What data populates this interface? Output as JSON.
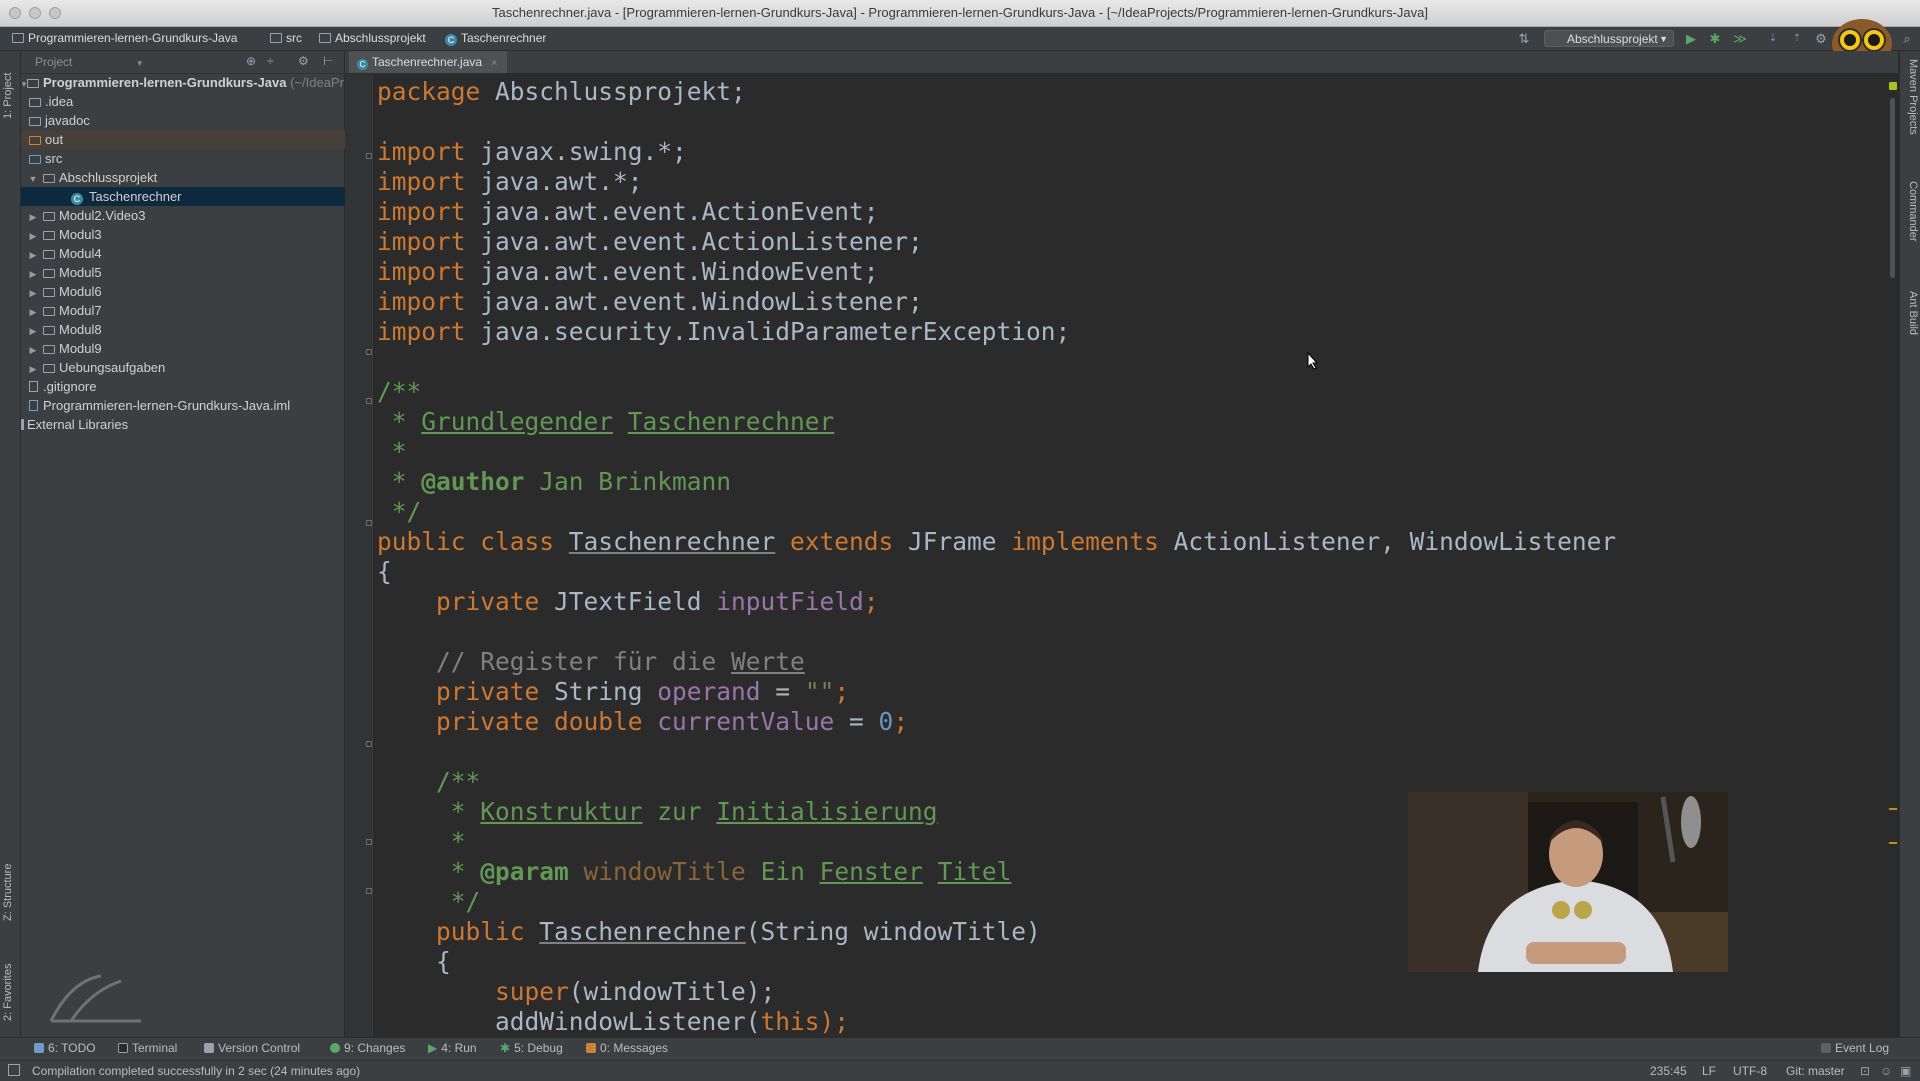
{
  "window": {
    "title": "Taschenrechner.java - [Programmieren-lernen-Grundkurs-Java] - Programmieren-lernen-Grundkurs-Java - [~/IdeaProjects/Programmieren-lernen-Grundkurs-Java]"
  },
  "breadcrumb": [
    "Programmieren-lernen-Grundkurs-Java",
    "src",
    "Abschlussprojekt",
    "Taschenrechner"
  ],
  "toolbar": {
    "run_config": "Abschlussprojekt"
  },
  "left_stripe": {
    "project_tab": "1: Project",
    "structure_tab": "Z: Structure",
    "favorites_tab": "2: Favorites"
  },
  "right_stripe": {
    "maven_tab": "Maven Projects",
    "commander_tab": "Commander",
    "ant_tab": "Ant Build"
  },
  "project": {
    "view_label": "Project",
    "root": {
      "name": "Programmieren-lernen-Grundkurs-Java",
      "path": "(~/IdeaPr"
    },
    "items": [
      {
        "label": ".idea"
      },
      {
        "label": "javadoc"
      },
      {
        "label": "out"
      },
      {
        "label": "src"
      },
      {
        "label": "Abschlussprojekt"
      },
      {
        "label": "Taschenrechner"
      },
      {
        "label": "Modul2.Video3"
      },
      {
        "label": "Modul3"
      },
      {
        "label": "Modul4"
      },
      {
        "label": "Modul5"
      },
      {
        "label": "Modul6"
      },
      {
        "label": "Modul7"
      },
      {
        "label": "Modul8"
      },
      {
        "label": "Modul9"
      },
      {
        "label": "Uebungsaufgaben"
      },
      {
        "label": ".gitignore"
      },
      {
        "label": "Programmieren-lernen-Grundkurs-Java.iml"
      },
      {
        "label": "External Libraries"
      }
    ]
  },
  "editor": {
    "tab_label": "Taschenrechner.java",
    "lines": {
      "l1": [
        "package",
        " Abschlussprojekt;"
      ],
      "l3": [
        "import",
        " javax.swing.*;"
      ],
      "l4": [
        "import",
        " java.awt.*;"
      ],
      "l5": [
        "import",
        " java.awt.event.ActionEvent;"
      ],
      "l6": [
        "import",
        " java.awt.event.ActionListener;"
      ],
      "l7": [
        "import",
        " java.awt.event.WindowEvent;"
      ],
      "l8": [
        "import",
        " java.awt.event.WindowListener;"
      ],
      "l9": [
        "import",
        " java.security.InvalidParameterException;"
      ],
      "l11": "/**",
      "l12": [
        " * ",
        "Grundlegender",
        " ",
        "Taschenrechner"
      ],
      "l13": " *",
      "l14": [
        " * ",
        "@author",
        " Jan Brinkmann"
      ],
      "l15": " */",
      "l16": [
        "public class ",
        "Taschenrechner",
        " extends ",
        "JFrame",
        " implements ",
        "ActionListener, WindowListener"
      ],
      "l17": "{",
      "l18": [
        "    private ",
        "JTextField ",
        "inputField",
        ";"
      ],
      "l20": [
        "    // Register für die ",
        "Werte"
      ],
      "l21": [
        "    private ",
        "String ",
        "operand",
        " = ",
        "\"\"",
        ";"
      ],
      "l22": [
        "    private double ",
        "currentValue",
        " = ",
        "0",
        ";"
      ],
      "l24": "    /**",
      "l25": [
        "     * ",
        "Konstruktur",
        " zur ",
        "Initialisierung"
      ],
      "l26": "     *",
      "l27": [
        "     * ",
        "@param",
        " ",
        "windowTitle",
        " Ein ",
        "Fenster",
        " ",
        "Titel"
      ],
      "l28": "     */",
      "l29": [
        "    public ",
        "Taschenrechner",
        "(String windowTitle)"
      ],
      "l30": "    {",
      "l31": [
        "        super",
        "(windowTitle);"
      ],
      "l32": [
        "        addWindowListener(",
        "this",
        ");"
      ]
    }
  },
  "bottom_tabs": [
    {
      "label": "6: TODO"
    },
    {
      "label": "Terminal"
    },
    {
      "label": "Version Control"
    },
    {
      "label": "9: Changes"
    },
    {
      "label": "4: Run"
    },
    {
      "label": "5: Debug"
    },
    {
      "label": "0: Messages"
    },
    {
      "label": "Event Log"
    }
  ],
  "status": {
    "message": "Compilation completed successfully in 2 sec (24 minutes ago)",
    "position": "235:45",
    "line_sep": "LF",
    "encoding": "UTF-8",
    "git": "Git: master"
  },
  "colors": {
    "keyword": "#cc7832",
    "comment": "#629755",
    "line_comment": "#808080",
    "number": "#6897bb",
    "field": "#9876aa",
    "editor_bg": "#2b2b2b",
    "panel_bg": "#3c3f41",
    "selection": "#0d293e"
  }
}
